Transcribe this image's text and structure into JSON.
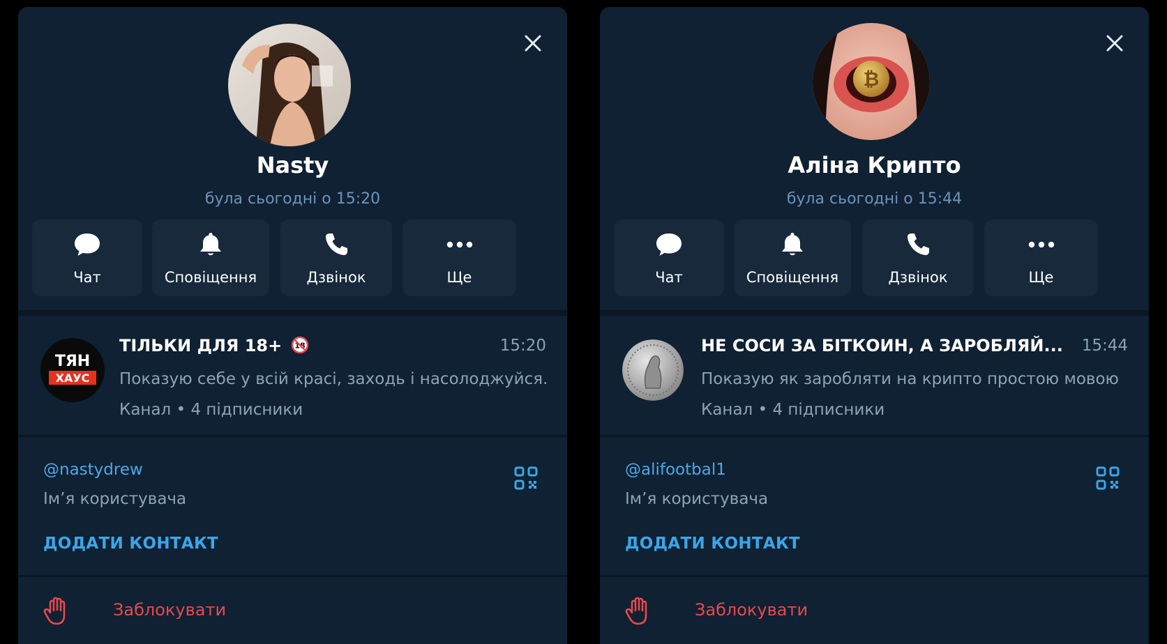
{
  "colors": {
    "background": "#0f2132",
    "action_bg": "#17293b",
    "accent": "#3aa6ea",
    "secondary_text": "#8ea3b6",
    "danger": "#e8484f"
  },
  "profiles": [
    {
      "name": "Nasty",
      "last_seen": "була сьогодні о 15:20",
      "avatar": "photo-woman-avatar",
      "actions": [
        {
          "label": "Чат",
          "icon": "chat-bubble-icon"
        },
        {
          "label": "Сповіщення",
          "icon": "bell-icon"
        },
        {
          "label": "Дзвінок",
          "icon": "phone-icon"
        },
        {
          "label": "Ще",
          "icon": "more-dots-icon"
        }
      ],
      "channel": {
        "logo_line1": "ТЯН",
        "logo_line2": "ХАУС",
        "title": "ТІЛЬКИ ДЛЯ 18+",
        "badge": "18",
        "time": "15:20",
        "description": "Показую себе у всій красі, заходь і насолоджуйся...",
        "meta": "Канал • 4 підписники"
      },
      "username": "@nastydrew",
      "username_label": "Ім’я користувача",
      "add_contact": "ДОДАТИ КОНТАКТ",
      "block": "Заблокувати"
    },
    {
      "name": "Аліна Крипто",
      "last_seen": "була сьогодні о 15:44",
      "avatar": "photo-lips-bitcoin-avatar",
      "actions": [
        {
          "label": "Чат",
          "icon": "chat-bubble-icon"
        },
        {
          "label": "Сповіщення",
          "icon": "bell-icon"
        },
        {
          "label": "Дзвінок",
          "icon": "phone-icon"
        },
        {
          "label": "Ще",
          "icon": "more-dots-icon"
        }
      ],
      "channel": {
        "title": "НЕ СОСИ ЗА БІТКОИН, А ЗАРОБЛЯЙ...",
        "time": "15:44",
        "description": "Показую як заробляти на крипто простою мовою",
        "meta": "Канал • 4 підписники"
      },
      "username": "@alifootbal1",
      "username_label": "Ім’я користувача",
      "add_contact": "ДОДАТИ КОНТАКТ",
      "block": "Заблокувати"
    }
  ]
}
